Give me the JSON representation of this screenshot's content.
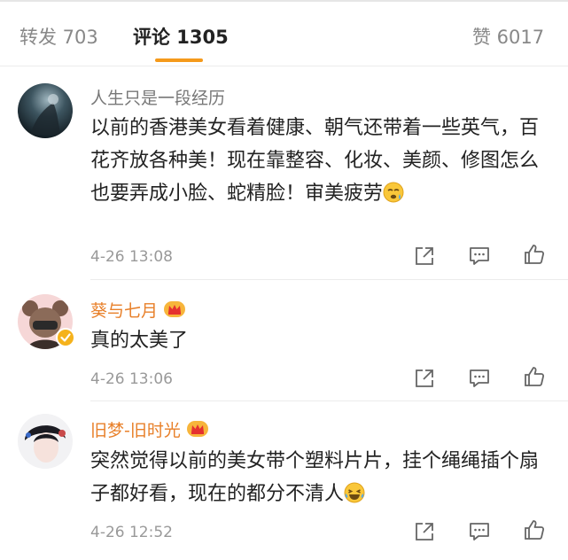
{
  "tabs": {
    "repost": "转发 703",
    "comments": "评论 1305",
    "likes": "赞 6017"
  },
  "comments": [
    {
      "username": "人生只是一段经历",
      "text": "以前的香港美女看着健康、朝气还带着一些英气，百花齐放各种美！现在靠整容、化妆、美颜、修图怎么也要弄成小脸、蛇精脸！审美疲劳",
      "emoji": "tired-face-emoji",
      "time": "4-26 13:08"
    },
    {
      "username": "葵与七月",
      "badge": "vip-crown-icon",
      "verified": "verified-badge-icon",
      "text": "真的太美了",
      "time": "4-26 13:06"
    },
    {
      "username": "旧梦-旧时光",
      "badge": "vip-crown-icon",
      "text": "突然觉得以前的美女带个塑料片片，挂个绳绳插个扇子都好看，现在的都分不清人",
      "emoji": "laughing-tears-emoji",
      "time": "4-26 12:52"
    }
  ],
  "actions": [
    "share-icon",
    "reply-icon",
    "like-icon"
  ],
  "colors": {
    "accent": "#f59a1b",
    "vip_name": "#e8802a",
    "muted": "#999999"
  }
}
